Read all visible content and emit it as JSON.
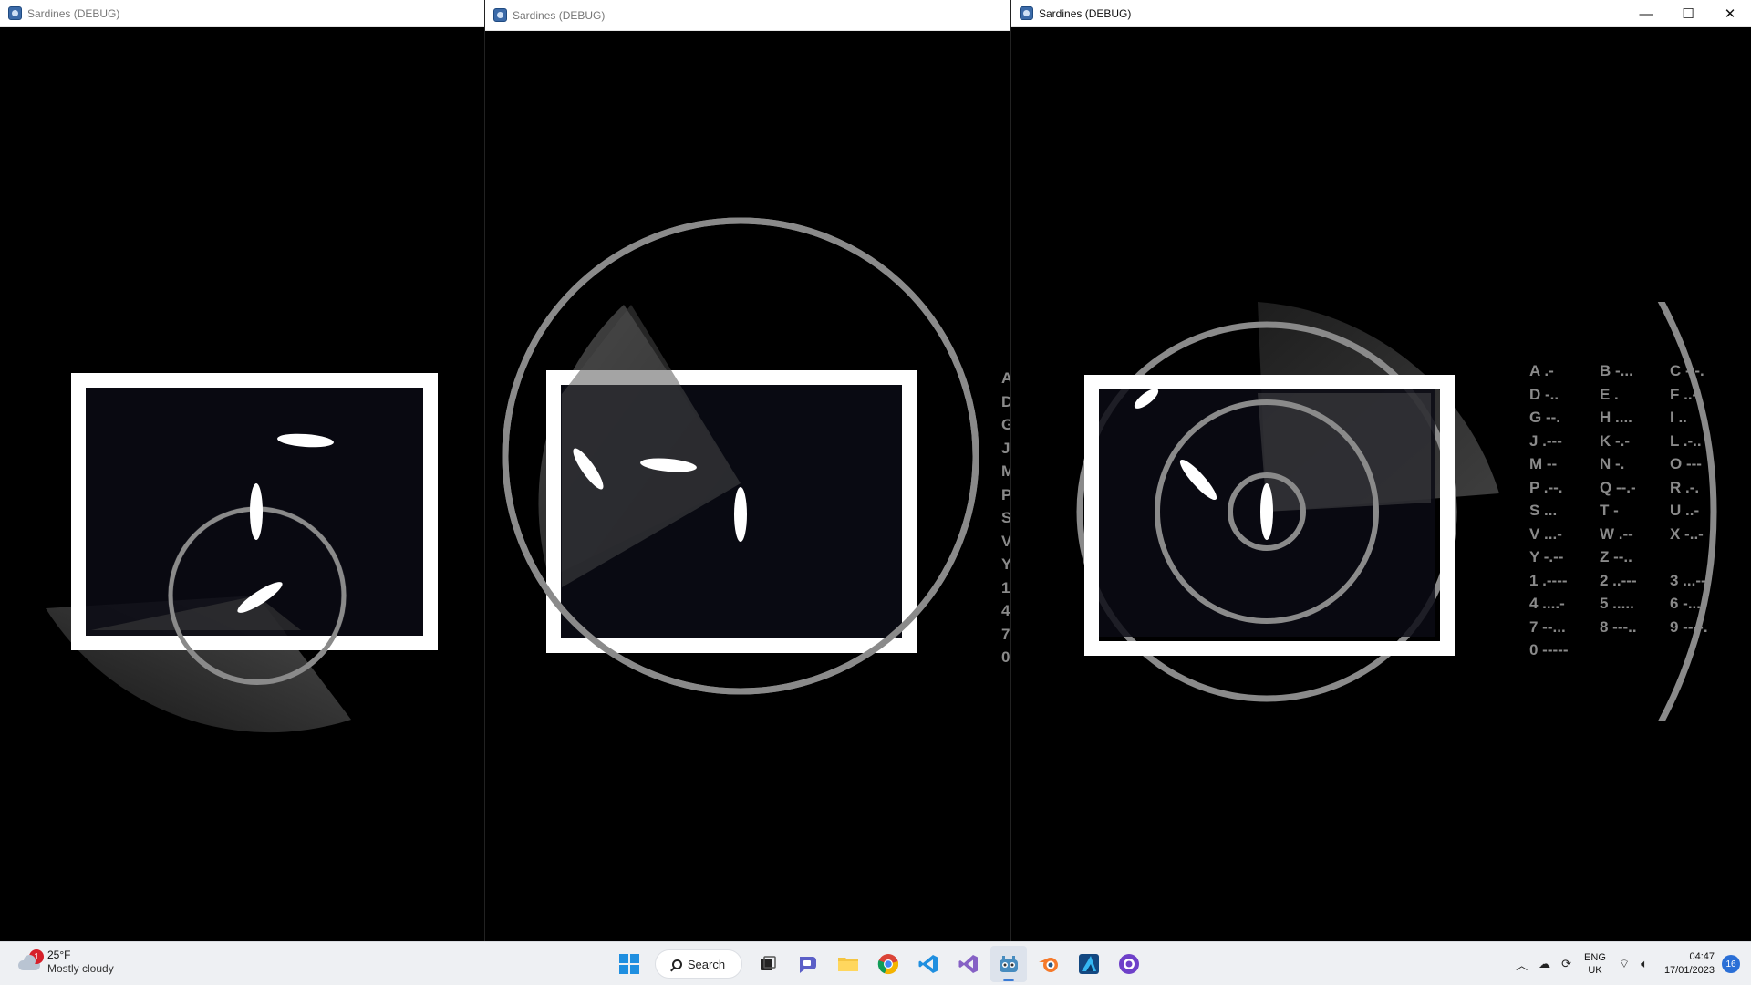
{
  "windows": [
    {
      "title": "Sardines (DEBUG)",
      "active": false
    },
    {
      "title": "Sardines (DEBUG)",
      "active": false
    },
    {
      "title": "Sardines (DEBUG)",
      "active": true,
      "controls": {
        "minimize": "—",
        "maximize": "☐",
        "close": "✕"
      }
    }
  ],
  "morse": [
    [
      "A .-",
      "B -...",
      "C -.-."
    ],
    [
      "D -..",
      "E .",
      "F ..-."
    ],
    [
      "G --.",
      "H ....",
      "I .."
    ],
    [
      "J .---",
      "K -.-",
      "L .-.."
    ],
    [
      "M --",
      "N -.",
      "O ---"
    ],
    [
      "P .--.",
      "Q --.-",
      "R .-."
    ],
    [
      "S ...",
      "T -",
      "U ..-"
    ],
    [
      "V ...-",
      "W .--",
      "X -..-"
    ],
    [
      "Y -.--",
      "Z --..",
      ""
    ],
    [
      "1 .----",
      "2 ..---",
      "3 ...--"
    ],
    [
      "4 ....-",
      "5 .....",
      "6 -...."
    ],
    [
      "7 --...",
      "8 ---..",
      "9 ----."
    ],
    [
      "0 -----",
      "",
      ""
    ]
  ],
  "morse_partial": [
    "A",
    "D",
    "G",
    "J",
    "M",
    "P",
    "S",
    "V",
    "Y",
    "1",
    "4",
    "7",
    "0"
  ],
  "taskbar": {
    "weather": {
      "temp": "25°F",
      "condition": "Mostly cloudy",
      "badge": "1"
    },
    "search_label": "Search",
    "apps": [
      "start-icon",
      "task-view-icon",
      "teams-chat-icon",
      "file-explorer-icon",
      "chrome-icon",
      "vscode-icon",
      "visual-studio-icon",
      "godot-icon",
      "blender-icon",
      "affinity-designer-icon",
      "github-desktop-icon"
    ],
    "tray": {
      "lang_line1": "ENG",
      "lang_line2": "UK",
      "time": "04:47",
      "date": "17/01/2023",
      "notifications": "16"
    }
  },
  "colors": {
    "panel": "#0a0b14",
    "ring": "#8a8a8a",
    "frame": "#ffffff",
    "taskbar": "#eef0f3"
  }
}
